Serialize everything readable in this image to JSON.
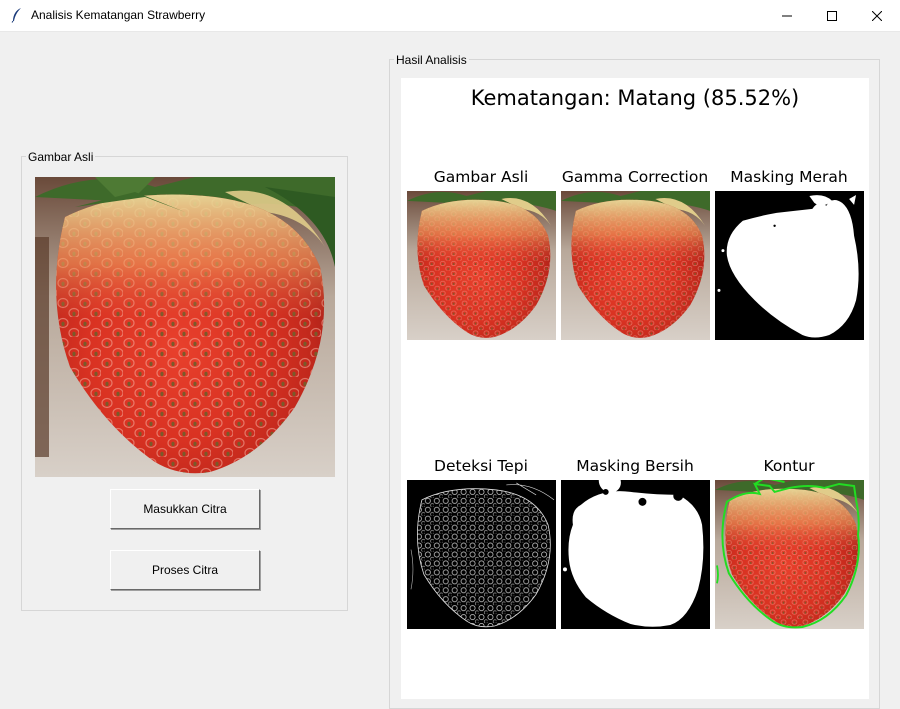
{
  "window": {
    "title": "Analisis Kematangan Strawberry",
    "controls": [
      "minimize",
      "maximize",
      "close"
    ]
  },
  "left_panel": {
    "label": "Gambar Asli",
    "buttons": {
      "load": "Masukkan Citra",
      "process": "Proses Citra"
    }
  },
  "right_panel": {
    "label": "Hasil Analisis",
    "result_title": "Kematangan: Matang (85.52%)",
    "panels": [
      {
        "title": "Gambar Asli",
        "icon": "strawberry-photo"
      },
      {
        "title": "Gamma Correction",
        "icon": "strawberry-photo"
      },
      {
        "title": "Masking Merah",
        "icon": "binary-mask"
      },
      {
        "title": "Deteksi Tepi",
        "icon": "edge-map"
      },
      {
        "title": "Masking Bersih",
        "icon": "binary-mask"
      },
      {
        "title": "Kontur",
        "icon": "contour-overlay"
      }
    ]
  },
  "colors": {
    "window_bg": "#f0f0f0",
    "canvas_bg": "#ffffff",
    "contour_green": "#22dd22"
  }
}
